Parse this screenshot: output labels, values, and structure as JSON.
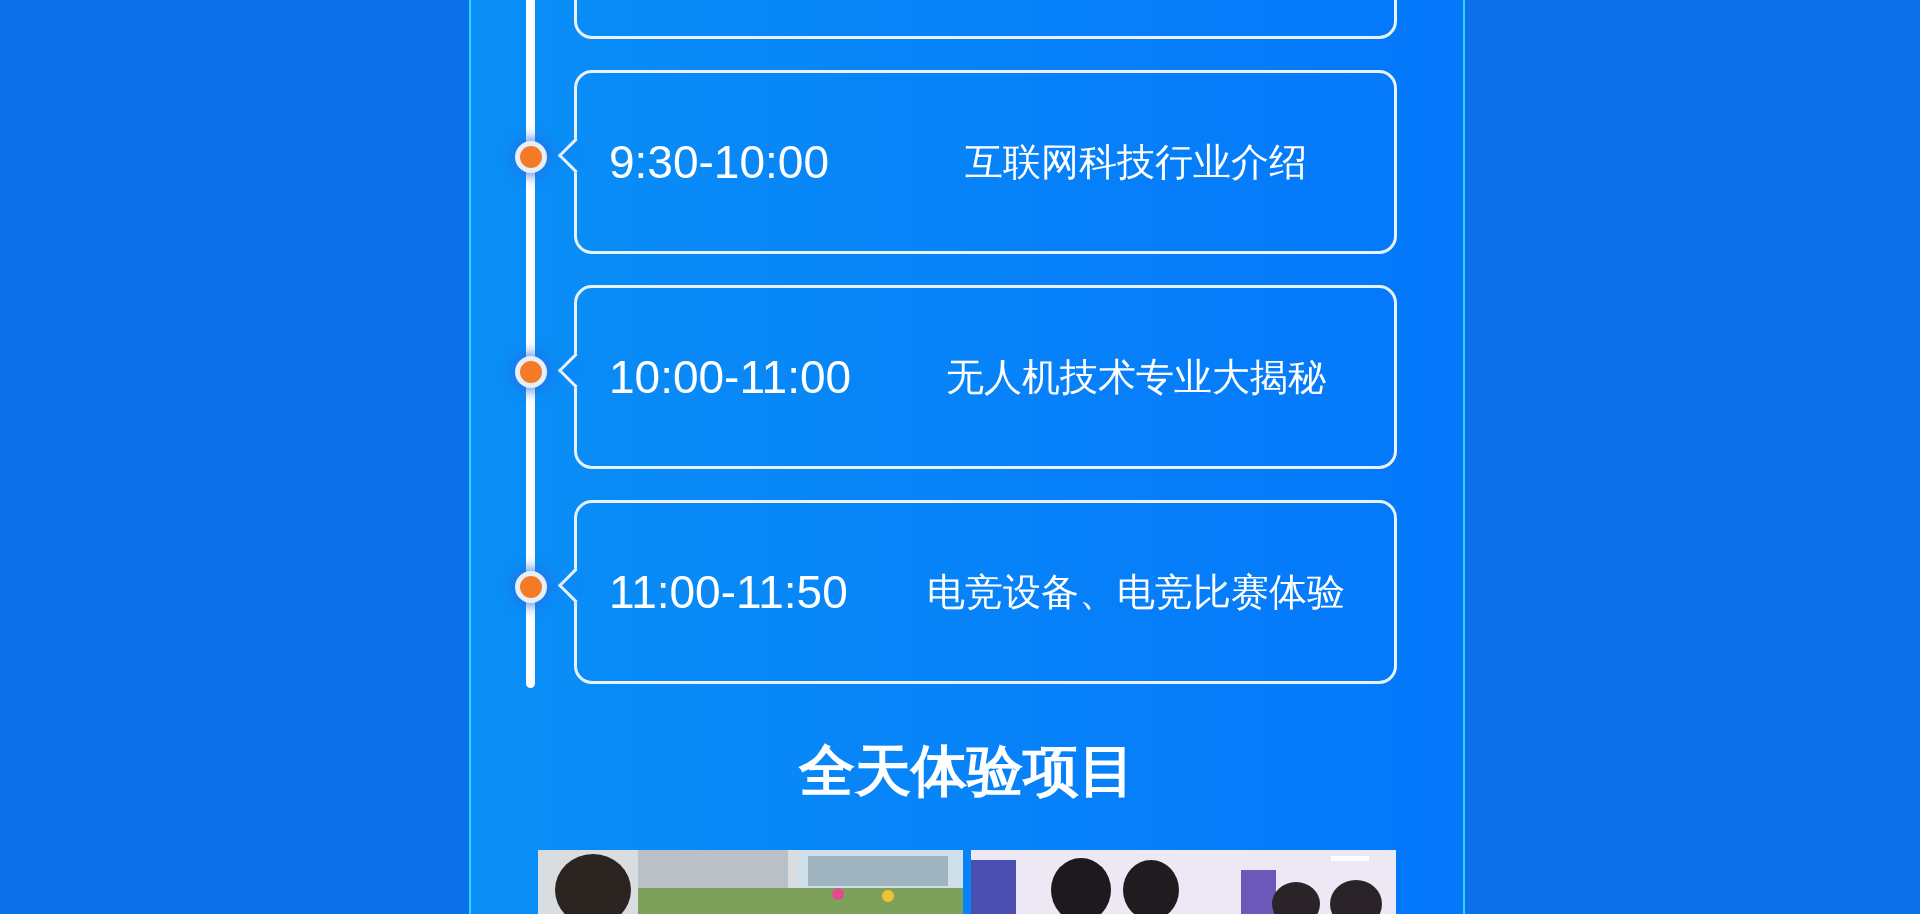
{
  "schedule": [
    {
      "time": "9:30-10:00",
      "topic": "互联网科技行业介绍"
    },
    {
      "time": "10:00-11:00",
      "topic": "无人机技术专业大揭秘"
    },
    {
      "time": "11:00-11:50",
      "topic": "电竞设备、电竞比赛体验"
    }
  ],
  "section_title": "全天体验项目"
}
